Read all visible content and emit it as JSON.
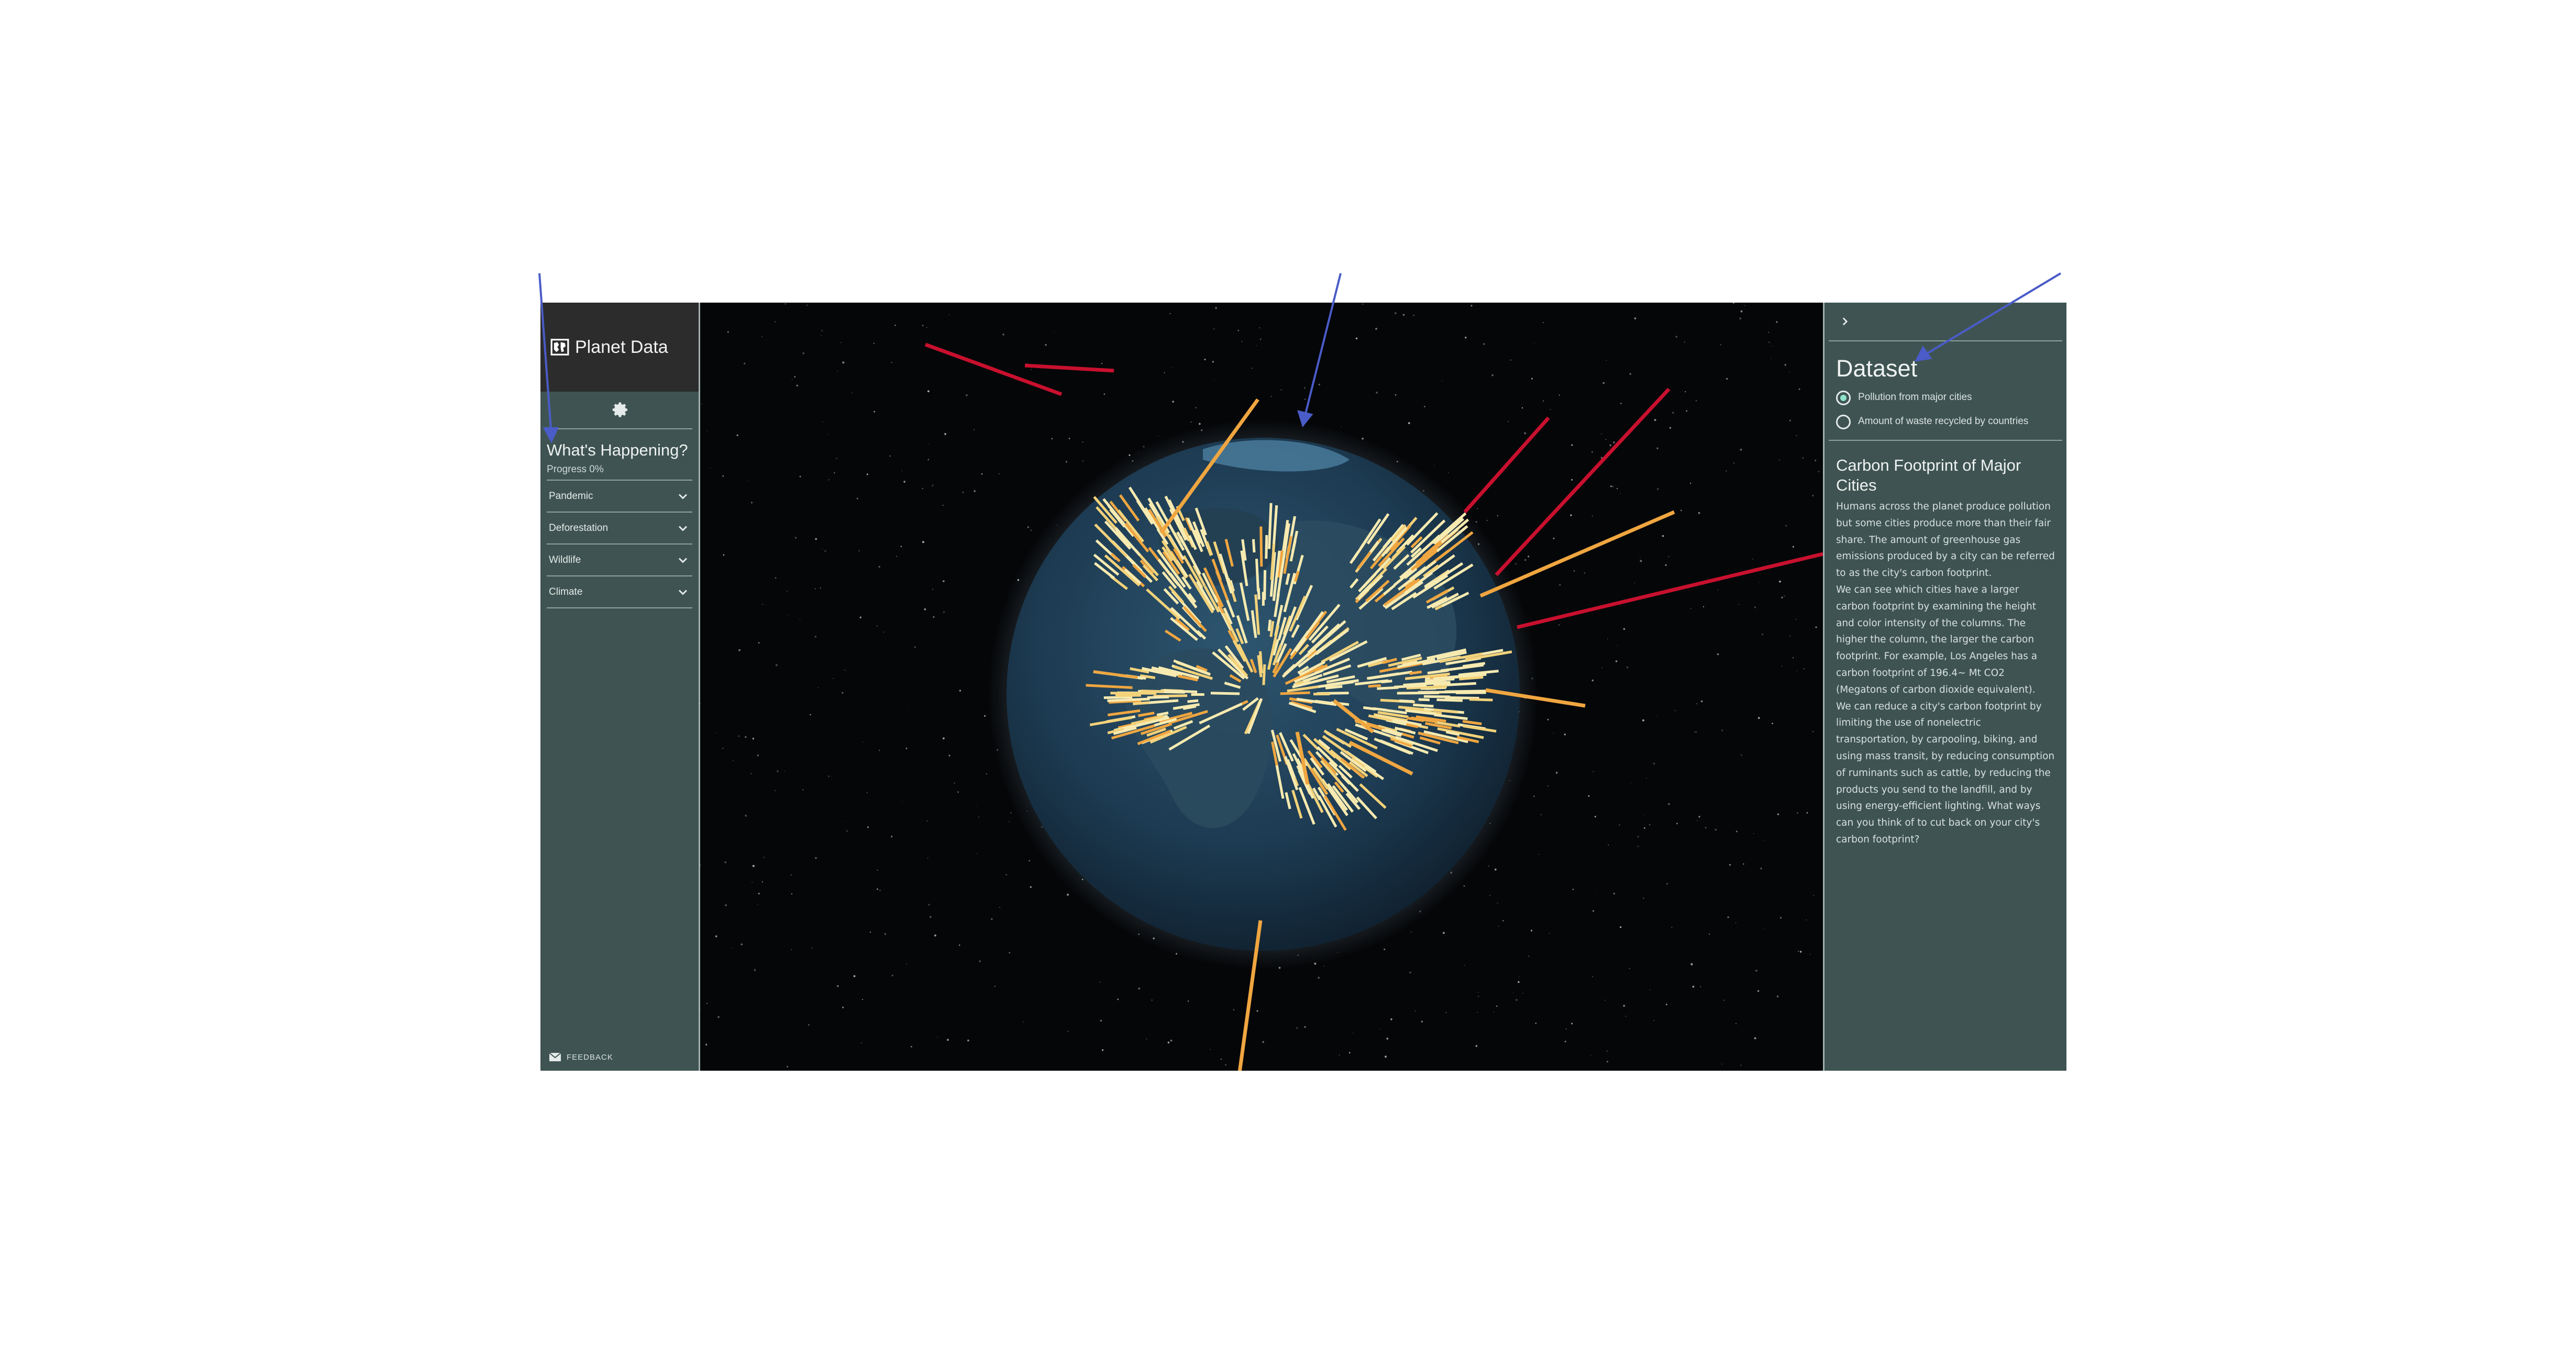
{
  "sidebar": {
    "brand": "Planet Data",
    "section_title": "What's Happening?",
    "progress": "Progress 0%",
    "items": [
      {
        "label": "Pandemic"
      },
      {
        "label": "Deforestation"
      },
      {
        "label": "Wildlife"
      },
      {
        "label": "Climate"
      }
    ],
    "feedback": "FEEDBACK"
  },
  "panel": {
    "title": "Dataset",
    "options": [
      {
        "label": "Pollution from major cities",
        "selected": true
      },
      {
        "label": "Amount of waste recycled by countries",
        "selected": false
      }
    ],
    "article_title": "Carbon Footprint of Major Cities",
    "paragraphs": [
      "Humans across the planet produce pollution but some cities produce more than their fair share. The amount of greenhouse gas emissions produced by a city can be referred to as the city's carbon footprint.",
      "We can see which cities have a larger carbon footprint by examining the height and color intensity of the columns. The higher the column, the larger the carbon footprint. For example, Los Angeles has a carbon footprint of 196.4~ Mt CO2 (Megatons of carbon dioxide equivalent).",
      "We can reduce a city's carbon footprint by limiting the use of nonelectric transportation, by carpooling, biking, and using mass transit, by reducing consumption of ruminants such as cattle, by reducing the products you send to the landfill, and by using energy-efficient lighting. What ways can you think of to cut back on your city's carbon footprint?"
    ]
  },
  "colors": {
    "sidebar": "#3f5452",
    "brand_bar": "#2c2c2c",
    "space": "#050608",
    "ocean": "#1f3d55",
    "accent": "#8fe3c8",
    "annotation": "#4a5cc8",
    "column_low": "#f7eab0",
    "column_mid": "#f0a640",
    "column_high": "#c8102e"
  },
  "icons": {
    "logo": "globe-map-icon",
    "settings": "gear-icon",
    "expand": "chevron-down-icon",
    "collapse": "chevron-right-icon",
    "feedback": "mail-icon"
  }
}
